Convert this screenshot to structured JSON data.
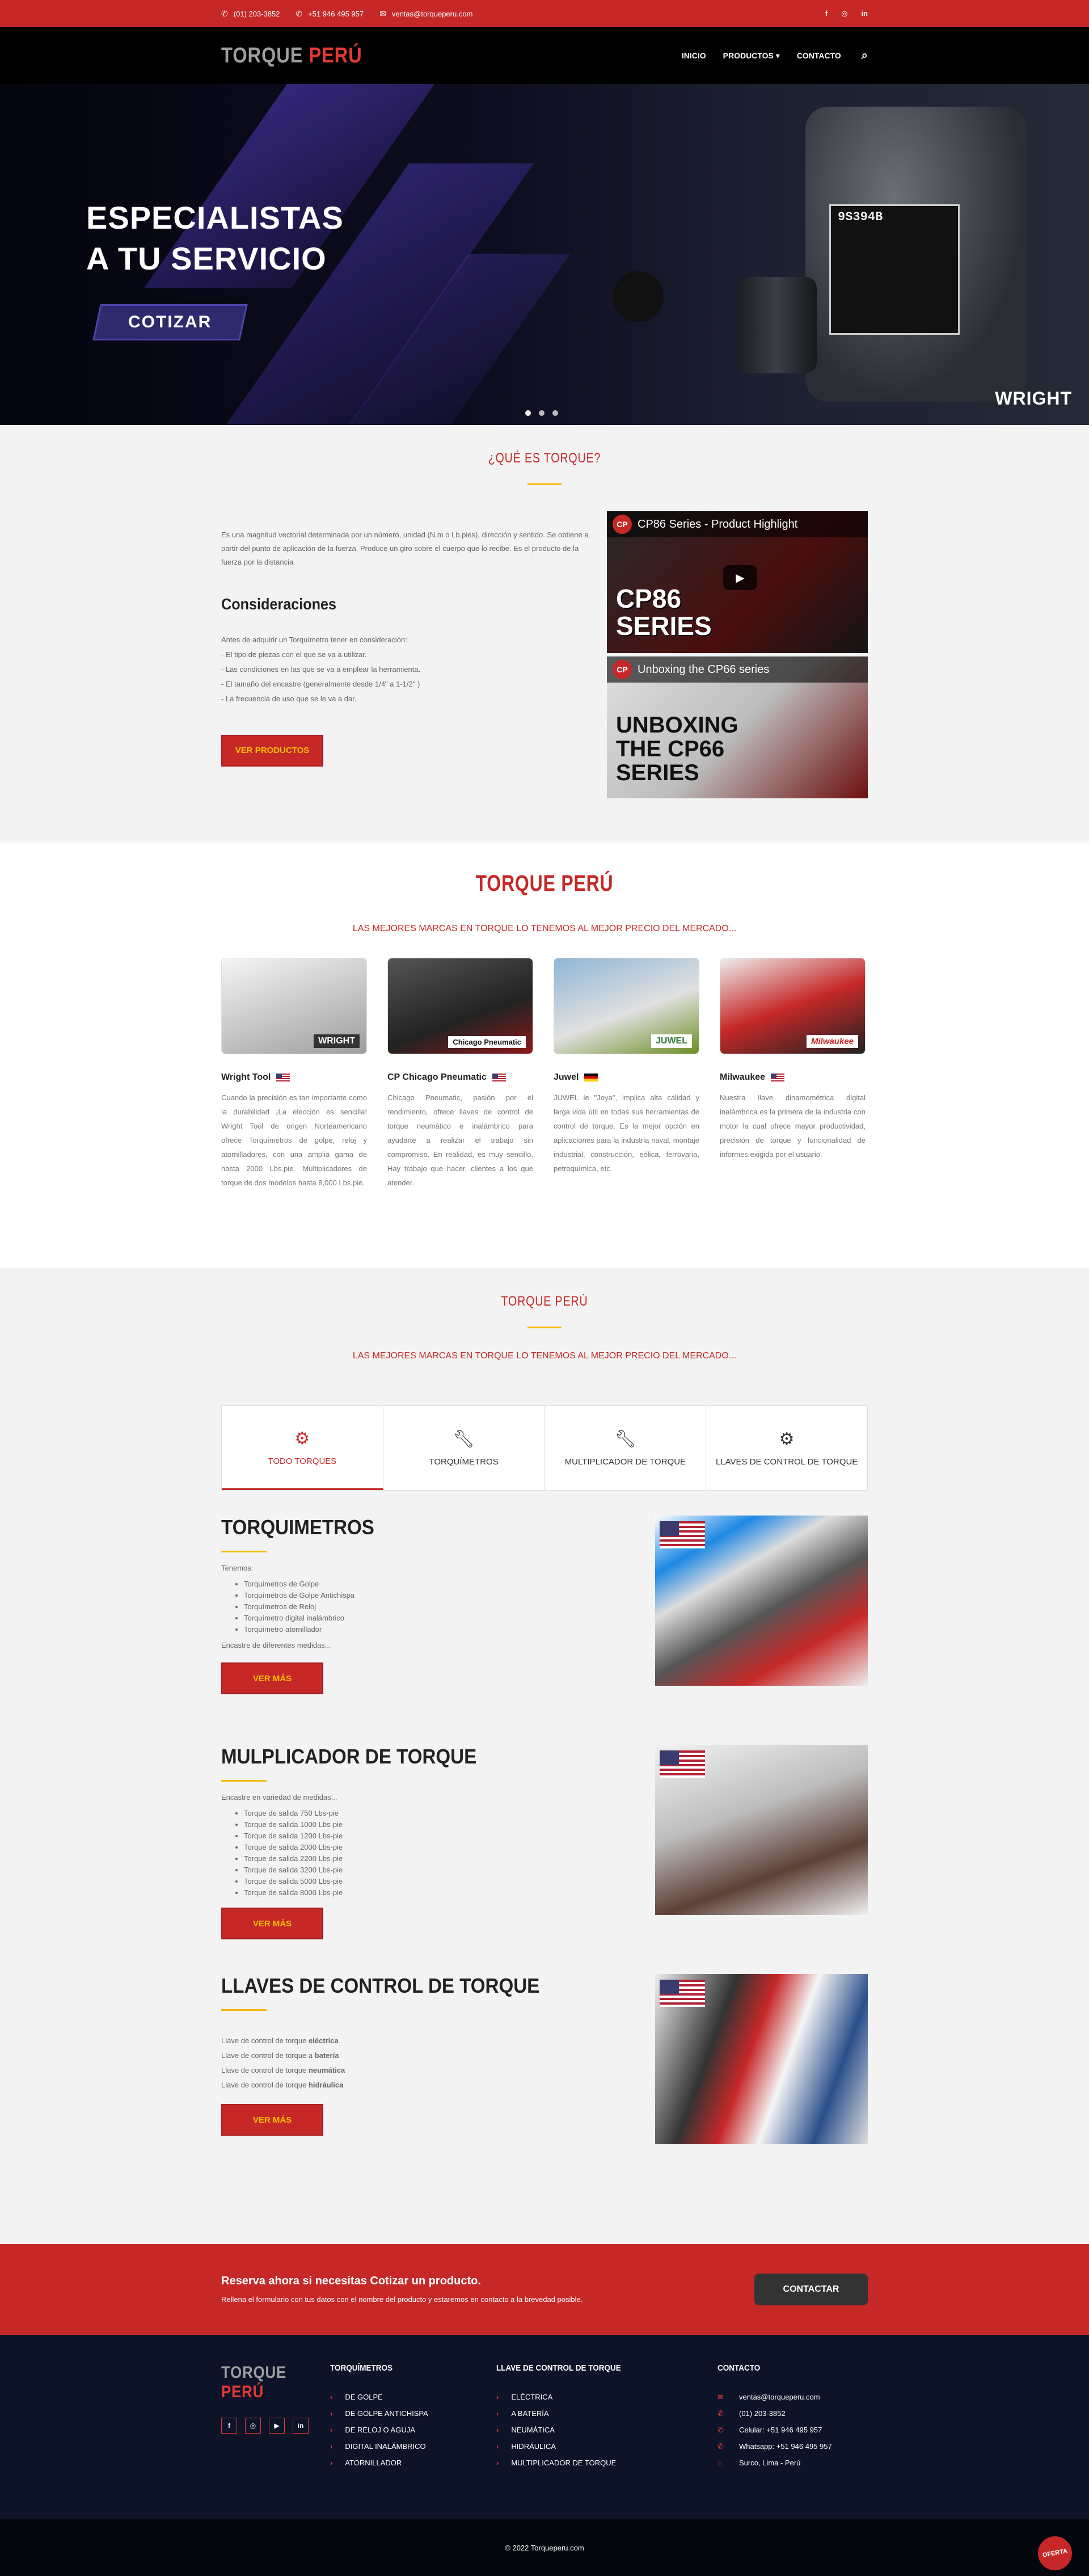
{
  "topbar": {
    "phone1": "(01) 203-3852",
    "phone2": "+51 946 495 957",
    "email": "ventas@torqueperu.com",
    "social": [
      "f",
      "◎",
      "in"
    ]
  },
  "logo": {
    "part1": "TORQUE ",
    "part2": "PERÚ"
  },
  "nav": {
    "items": [
      "INICIO",
      "PRODUCTOS ▾",
      "CONTACTO"
    ]
  },
  "hero": {
    "line1": "ESPECIALISTAS",
    "line2": "A TU SERVICIO",
    "button": "COTIZAR",
    "tool_label_title": "9S394B",
    "brand": "WRIGHT"
  },
  "que": {
    "title": "¿QUÉ ES TORQUE?",
    "paragraph": "Es una magnitud vectorial determinada por un número, unidad (N.m o Lb.pies), dirección y sentido. Se obtiene a partir del punto de aplicación de la fuerza. Produce un giro sobre el cuerpo que lo recibe. Es el producto de la fuerza por la distancia.",
    "heading": "Consideraciones",
    "intro": "Antes de adquirir un Torquímetro tener en consideración:",
    "list": [
      "- El tipo de piezas con el que se va a utilizar.",
      "- Las condiciones en las que se va a emplear la herramienta.",
      "- El tamaño del encastre (generalmente desde 1/4\" a 1-1/2\" )",
      "- La frecuencia de uso que se le va a dar."
    ],
    "button": "VER PRODUCTOS",
    "videos": [
      {
        "title": "CP86 Series - Product Highlight",
        "big": "CP86\nSERIES"
      },
      {
        "title": "Unboxing the CP66 series",
        "big": "UNBOXING\nTHE CP66\nSERIES"
      }
    ]
  },
  "torque": {
    "title": "TORQUE PERÚ",
    "subtitle": "LAS MEJORES MARCAS EN TORQUE LO TENEMOS AL MEJOR PRECIO DEL MERCADO...",
    "brands": [
      {
        "name": "Wright Tool",
        "flag": "us",
        "text": "Cuando la precisión es tan importante como la durabilidad ¡La elección es sencilla! Wright Tool de origen Norteamericano ofrece Torquímetros de golpe, reloj y atornilladores, con una amplia gama de hasta 2000 Lbs.pie. Multiplicadores de torque de dos modelos hasta 8,000 Lbs.pie.",
        "img_tag": "WRIGHT"
      },
      {
        "name": "CP Chicago Pneumatic",
        "flag": "us",
        "text": "Chicago Pneumatic, pasión por el rendimiento, ofrece llaves de control de torque neumático e inalámbrico para ayudarte a realizar el trabajo sin compromiso. En realidad, es muy sencillo. Hay trabajo que hacer, clientes a los que atender.",
        "img_tag": "Chicago Pneumatic"
      },
      {
        "name": "Juwel",
        "flag": "de",
        "text": "JUWEL le \"Joya\", implica alta calidad y larga vida útil en todas sus herramientas de control de torque. Es la mejor opción en aplicaciones para la industria naval, montaje industrial, construcción, eólica, ferrovaria, petroquímica, etc.",
        "img_tag": "JUWEL"
      },
      {
        "name": "Milwaukee",
        "flag": "us",
        "text": "Nuestra llave dinamométrica digital inalámbrica es la primera de la industria con motor la cual ofrece mayor productividad, precisión de torque y funcionalidad de informes exigida por el usuario.",
        "img_tag": "Milwaukee"
      }
    ]
  },
  "cats": {
    "title": "TORQUE PERÚ",
    "subtitle": "LAS MEJORES MARCAS EN TORQUE LO TENEMOS AL MEJOR PRECIO DEL MERCADO...",
    "tabs": [
      {
        "label": "TODO TORQUES",
        "icon": "⚙"
      },
      {
        "label": "TORQUÍMETROS",
        "icon": "🔧"
      },
      {
        "label": "MULTIPLICADOR DE TORQUE",
        "icon": "🔧"
      },
      {
        "label": "LLAVES DE CONTROL DE TORQUE",
        "icon": "⚙"
      }
    ],
    "sections": [
      {
        "title": "TORQUIMETROS",
        "intro": "Tenemos:",
        "items": [
          "Torquímetros de Golpe",
          "Torquímetros de Golpe Antichispa",
          "Torquímetros de Reloj",
          "Torquímetro digital inalámbrico",
          "Torquímetro atornillador"
        ],
        "outro": "Encastre de diferentes medidas...",
        "button": "VER MÁS"
      },
      {
        "title": "MULPLICADOR DE TORQUE",
        "intro": "Encastre en variedad de medidas...",
        "items": [
          "Torque de salida 750 Lbs-pie",
          "Torque de salida 1000 Lbs-pie",
          "Torque de salida 1200 Lbs-pie",
          "Torque de salida 2000 Lbs-pie",
          "Torque de salida 2200 Lbs-pie",
          "Torque de salida 3200 Lbs-pie",
          "Torque de salida 5000 Lbs-pie",
          "Torque de salida 8000 Lbs-pie"
        ],
        "outro": "",
        "button": "VER MÁS"
      },
      {
        "title": "LLAVES DE CONTROL DE TORQUE",
        "intro": "",
        "items": [],
        "lines": [
          [
            "Llave de control de torque ",
            "eléctrica"
          ],
          [
            "Llave de control de torque a ",
            "batería"
          ],
          [
            "Llave de control de torque ",
            "neumática"
          ],
          [
            "Llave de control de torque ",
            "hidráulica"
          ]
        ],
        "outro": "",
        "button": "VER MÁS"
      }
    ]
  },
  "cta": {
    "title": "Reserva ahora si necesitas Cotizar un producto.",
    "text": "Rellena el formulario con tus datos con el nombre del producto y estaremos en contacto a la brevedad posible.",
    "button": "CONTACTAR"
  },
  "footer": {
    "logo1": "TORQUE ",
    "logo2": "PERÚ",
    "social": [
      "f",
      "◎",
      "▶",
      "in"
    ],
    "col1": {
      "title": "TORQUÍMETROS",
      "items": [
        "DE GOLPE",
        "DE GOLPE ANTICHISPA",
        "DE RELOJ O AGUJA",
        "DIGITAL INALÁMBRICO",
        "ATORNILLADOR"
      ]
    },
    "col2": {
      "title": "LLAVE DE CONTROL DE TORQUE",
      "items": [
        "ELÉCTRICA",
        "A BATERÍA",
        "NEUMÁTICA",
        "HIDRÁULICA",
        "MULTIPLICADOR DE TORQUE"
      ]
    },
    "col3": {
      "title": "CONTACTO",
      "items": [
        {
          "icon": "✉",
          "text": "ventas@torqueperu.com"
        },
        {
          "icon": "✆",
          "text": "(01) 203-3852"
        },
        {
          "icon": "✆",
          "text": "Celular: +51 946 495 957"
        },
        {
          "icon": "✆",
          "text": "Whatsapp: +51 946 495 957"
        },
        {
          "icon": "⌂",
          "text": "Surco, Lima - Perú"
        }
      ]
    },
    "copyright": "© 2022 Torqueperu.com",
    "badge": "OFERTA"
  },
  "colors": {
    "primary": "#c62828",
    "accent": "#f5b800",
    "dark": "#0e1428"
  }
}
